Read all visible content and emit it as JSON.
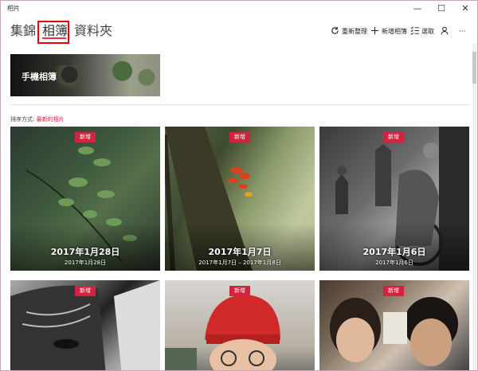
{
  "window": {
    "app_title": "相片",
    "controls": {
      "minimize": "—",
      "maximize": "☐",
      "close": "✕"
    }
  },
  "nav": {
    "tabs": [
      {
        "label": "集錦",
        "active": false
      },
      {
        "label": "相簿",
        "active": true
      },
      {
        "label": "資料夾",
        "active": false
      }
    ]
  },
  "toolbar": {
    "refresh_label": "重新整理",
    "new_album_label": "新增相簿",
    "select_label": "選取",
    "account_icon": "person-icon",
    "more_label": "···"
  },
  "featured_album": {
    "title": "手機相簿"
  },
  "sort": {
    "prefix": "排序方式:",
    "value": "最新的相片"
  },
  "albums": [
    {
      "badge": "新增",
      "title": "2017年1月28日",
      "range": "2017年1月28日"
    },
    {
      "badge": "新增",
      "title": "2017年1月7日",
      "range": "2017年1月7日 – 2017年1月8日"
    },
    {
      "badge": "新增",
      "title": "2017年1月6日",
      "range": "2017年1月6日"
    },
    {
      "badge": "新增"
    },
    {
      "badge": "新增"
    },
    {
      "badge": "新增"
    }
  ],
  "colors": {
    "accent": "#d4233f",
    "highlight_box": "#e00000"
  }
}
